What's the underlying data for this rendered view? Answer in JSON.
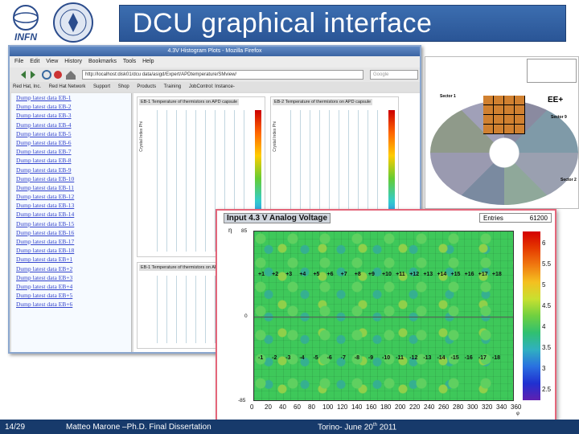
{
  "slide": {
    "title": "DCU graphical interface",
    "logo_text": "INFN",
    "footer_page": "14/29",
    "footer_author": "Matteo Marone –Ph.D. Final Dissertation",
    "footer_place_prefix": "Torino- June 20",
    "footer_place_sup": "th",
    "footer_place_suffix": " 2011"
  },
  "browser": {
    "title": "4.3V Histogram Plots - Mozilla Firefox",
    "menu": [
      "File",
      "Edit",
      "View",
      "History",
      "Bookmarks",
      "Tools",
      "Help"
    ],
    "url": "http://localhost:disk01/dcu data/asigd/Expert/APDtemperature/SMview/",
    "search_placeholder": "Google",
    "bookmarks": [
      "Red Hat, Inc.",
      "Red Hat Network",
      "Support",
      "Shop",
      "Products",
      "Training",
      "JobControl: Instance-"
    ],
    "links": [
      "Dump latest data EB-1",
      "Dump latest data EB-2",
      "Dump latest data EB-3",
      "Dump latest data EB-4",
      "Dump latest data EB-5",
      "Dump latest data EB-6",
      "Dump latest data EB-7",
      "Dump latest data EB-8",
      "Dump latest data EB-9",
      "Dump latest data EB-10",
      "Dump latest data EB-11",
      "Dump latest data EB-12",
      "Dump latest data EB-13",
      "Dump latest data EB-14",
      "Dump latest data EB-15",
      "Dump latest data EB-16",
      "Dump latest data EB-17",
      "Dump latest data EB-18",
      "Dump latest data EB+1",
      "Dump latest data EB+2",
      "Dump latest data EB+3",
      "Dump latest data EB+4",
      "Dump latest data EB+5",
      "Dump latest data EB+6"
    ],
    "hist_label": "EB-1 Temperature of thermistors on APD capsule",
    "hist_label2": "EB-2 Temperature of thermistors on APD capsule",
    "hist_ylabel": "Crystal Index Phi"
  },
  "endcap": {
    "title": "EE+",
    "sector_labels": [
      "Sector 1",
      "Sector 9",
      "Sector 2"
    ]
  },
  "plot": {
    "title": "Input 4.3 V Analog Voltage",
    "entries_label": "Entries",
    "entries_value": "61200",
    "y_axis_label": "η",
    "x_axis_label": "φ",
    "top_row_labels": [
      "+1",
      "+2",
      "+3",
      "+4",
      "+5",
      "+6",
      "+7",
      "+8",
      "+9",
      "+10",
      "+11",
      "+12",
      "+13",
      "+14",
      "+15",
      "+16",
      "+17",
      "+18"
    ],
    "bottom_row_labels": [
      "-1",
      "-2",
      "-3",
      "-4",
      "-5",
      "-6",
      "-7",
      "-8",
      "-9",
      "-10",
      "-11",
      "-12",
      "-13",
      "-14",
      "-15",
      "-16",
      "-17",
      "-18"
    ],
    "y_ticks": [
      "85",
      "0",
      "-85"
    ],
    "x_ticks": [
      "0",
      "20",
      "40",
      "60",
      "80",
      "100",
      "120",
      "140",
      "160",
      "180",
      "200",
      "220",
      "240",
      "260",
      "280",
      "300",
      "320",
      "340",
      "360"
    ],
    "colorbar_ticks": [
      "6",
      "5.5",
      "5",
      "4.5",
      "4",
      "3.5",
      "3",
      "2.5"
    ],
    "accent_color": "#e4667a"
  }
}
